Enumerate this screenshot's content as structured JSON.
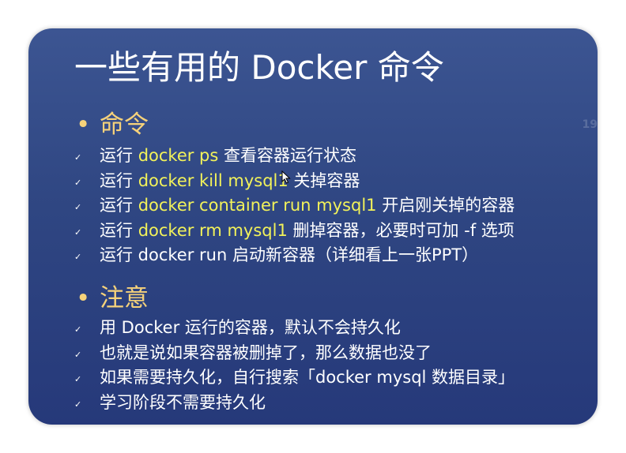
{
  "slide": {
    "title": "一些有用的 Docker 命令",
    "page_number": "19",
    "sections": [
      {
        "bullet": "•",
        "heading": "命令",
        "items": [
          {
            "prefix": "运行 ",
            "highlight": "docker ps",
            "suffix": " 查看容器运行状态"
          },
          {
            "prefix": "运行 ",
            "highlight": "docker kill mysql1",
            "suffix": " 关掉容器"
          },
          {
            "prefix": "运行 ",
            "highlight": "docker container run mysql1",
            "suffix": " 开启刚关掉的容器"
          },
          {
            "prefix": "运行 ",
            "highlight": "docker rm mysql1",
            "suffix": " 删掉容器，必要时可加 -f 选项"
          },
          {
            "prefix": "运行 docker run 启动新容器（详细看上一张PPT）",
            "highlight": "",
            "suffix": ""
          }
        ]
      },
      {
        "bullet": "•",
        "heading": "注意",
        "items": [
          {
            "prefix": "用 Docker 运行的容器，默认不会持久化",
            "highlight": "",
            "suffix": ""
          },
          {
            "prefix": "也就是说如果容器被删掉了，那么数据也没了",
            "highlight": "",
            "suffix": ""
          },
          {
            "prefix": "如果需要持久化，自行搜索「docker mysql 数据目录」",
            "highlight": "",
            "suffix": ""
          },
          {
            "prefix": "学习阶段不需要持久化",
            "highlight": "",
            "suffix": ""
          }
        ]
      }
    ],
    "check_glyph": "✓",
    "colors": {
      "background": "#2f4682",
      "heading": "#f6d27a",
      "highlight": "#f2f25a",
      "text": "#ffffff"
    }
  }
}
